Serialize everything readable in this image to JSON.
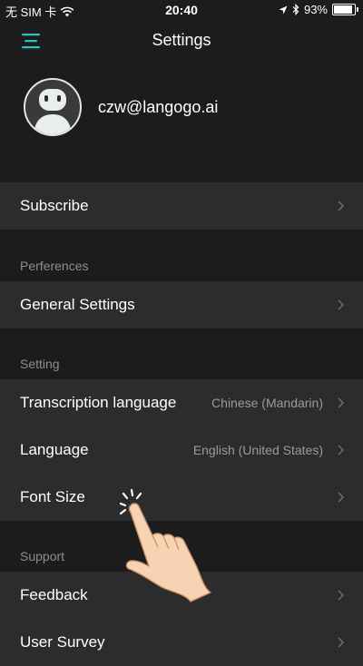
{
  "status_bar": {
    "carrier": "无 SIM 卡",
    "time": "20:40",
    "battery_percent": "93%",
    "battery_level": 0.93
  },
  "header": {
    "title": "Settings",
    "menu_icon": "hamburger-menu-icon",
    "accent_color": "#29c1c1"
  },
  "profile": {
    "email": "czw@langogo.ai",
    "avatar_icon": "robot-avatar-icon"
  },
  "rows": {
    "subscribe": {
      "label": "Subscribe"
    },
    "general_settings": {
      "label": "General Settings"
    },
    "transcription_language": {
      "label": "Transcription language",
      "value": "Chinese (Mandarin)"
    },
    "language": {
      "label": "Language",
      "value": "English (United States)"
    },
    "font_size": {
      "label": "Font Size"
    },
    "feedback": {
      "label": "Feedback"
    },
    "user_survey": {
      "label": "User Survey"
    }
  },
  "sections": {
    "preferences": "Perferences",
    "setting": "Setting",
    "support": "Support"
  },
  "colors": {
    "background": "#1c1c1e",
    "row_background": "#2c2c2e",
    "secondary_text": "#8e8e93"
  }
}
